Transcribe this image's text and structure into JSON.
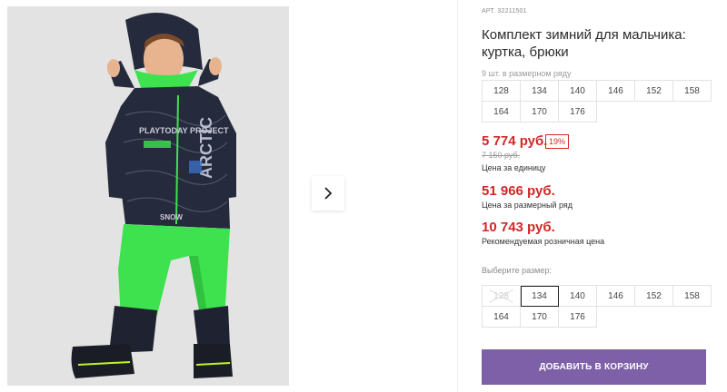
{
  "product": {
    "article": "АРТ. 32211501",
    "title": "Комплект зимний для мальчика: куртка, брюки",
    "row_note": "9 шт. в размерном ряду",
    "row_sizes": [
      "128",
      "134",
      "140",
      "146",
      "152",
      "158",
      "164",
      "170",
      "176"
    ],
    "photo_alt_text": [
      "ARCTIC",
      "PLAYTODAY PROJECT",
      "SNOW"
    ]
  },
  "pricing": {
    "price": "5 774 руб.",
    "discount": "19%",
    "old_price": "7 150 руб.",
    "unit_label": "Цена за единицу",
    "row_price": "51 966 руб.",
    "row_label": "Цена за размерный ряд",
    "rrp_price": "10 743 руб.",
    "rrp_label": "Рекомендуемая розничная цена"
  },
  "size_select": {
    "label": "Выберите размер:",
    "disabled_size": "128",
    "selected": "134",
    "sizes": [
      "140",
      "146",
      "152",
      "158",
      "164",
      "170",
      "176"
    ]
  },
  "actions": {
    "add_to_cart": "ДОБАВИТЬ В КОРЗИНУ"
  },
  "colors": {
    "price_red": "#d12727",
    "button_purple": "#7e60a8",
    "jacket_navy": "#262a3d",
    "pants_green": "#3ee24f"
  },
  "icons": {
    "next": "chevron-right-icon"
  }
}
